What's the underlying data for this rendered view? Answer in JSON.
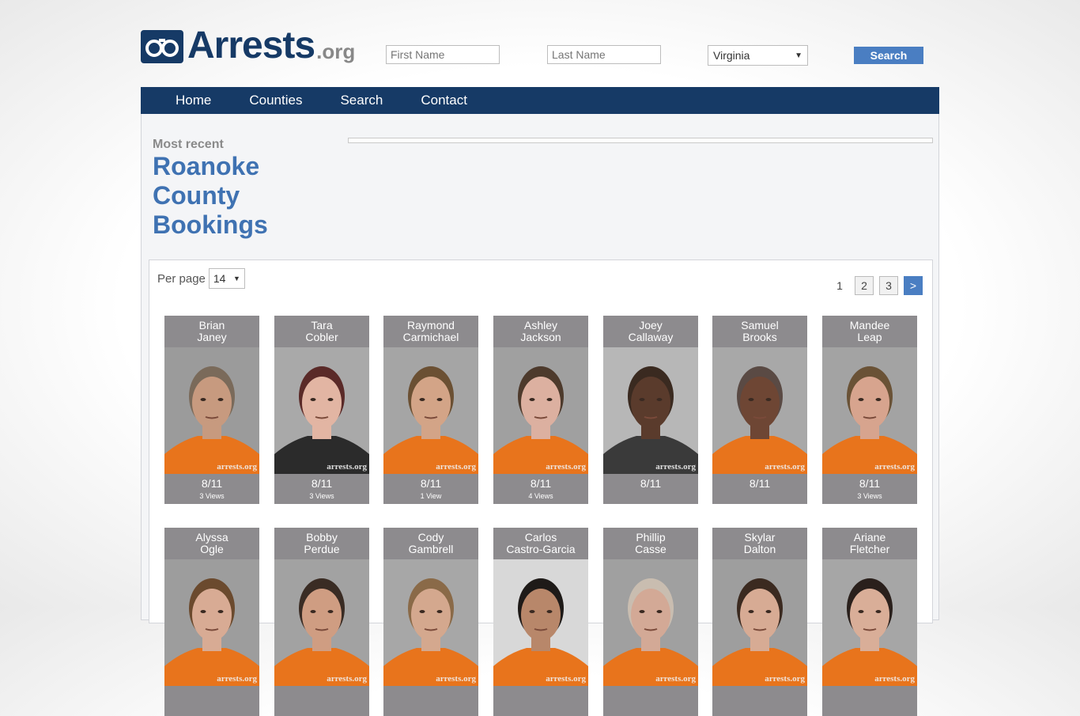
{
  "logo": {
    "brand": "Arrests",
    "tld": ".org"
  },
  "search": {
    "first_placeholder": "First Name",
    "last_placeholder": "Last Name",
    "state_selected": "Virginia",
    "button_label": "Search"
  },
  "nav": {
    "items": [
      "Home",
      "Counties",
      "Search",
      "Contact"
    ]
  },
  "page": {
    "eyebrow": "Most recent",
    "title": "Roanoke County Bookings"
  },
  "listing": {
    "per_page_label": "Per page",
    "per_page_value": "14",
    "pages": [
      "1",
      "2",
      "3"
    ],
    "current_page": "1",
    "next_label": ">"
  },
  "watermark": "arrests.org",
  "bookings": [
    {
      "first": "Brian",
      "last": "Janey",
      "date": "8/11",
      "views": "3 Views",
      "shirt": "#e8741c",
      "skin": "#c79a7f",
      "hair": "#7a6a5a",
      "bg": "#9b9b9b"
    },
    {
      "first": "Tara",
      "last": "Cobler",
      "date": "8/11",
      "views": "3 Views",
      "shirt": "#2b2b2b",
      "skin": "#e2b5a3",
      "hair": "#5a2a28",
      "bg": "#a9a9a9"
    },
    {
      "first": "Raymond",
      "last": "Carmichael",
      "date": "8/11",
      "views": "1 View",
      "shirt": "#e8741c",
      "skin": "#d3a487",
      "hair": "#6b5033",
      "bg": "#a5a5a5"
    },
    {
      "first": "Ashley",
      "last": "Jackson",
      "date": "8/11",
      "views": "4 Views",
      "shirt": "#e8741c",
      "skin": "#dcb0a0",
      "hair": "#4d3a2c",
      "bg": "#a0a0a0"
    },
    {
      "first": "Joey",
      "last": "Callaway",
      "date": "8/11",
      "views": "",
      "shirt": "#3a3a3a",
      "skin": "#5a3b2c",
      "hair": "#3a2a20",
      "bg": "#b7b7b7"
    },
    {
      "first": "Samuel",
      "last": "Brooks",
      "date": "8/11",
      "views": "",
      "shirt": "#e8741c",
      "skin": "#6e4634",
      "hair": "#5a4a44",
      "bg": "#a8a8a8"
    },
    {
      "first": "Mandee",
      "last": "Leap",
      "date": "8/11",
      "views": "3 Views",
      "shirt": "#e8741c",
      "skin": "#d7a48e",
      "hair": "#6a5236",
      "bg": "#a3a3a3"
    },
    {
      "first": "Alyssa",
      "last": "Ogle",
      "date": "",
      "views": "",
      "shirt": "#e8741c",
      "skin": "#d8ab94",
      "hair": "#6b4a2e",
      "bg": "#9d9d9d"
    },
    {
      "first": "Bobby",
      "last": "Perdue",
      "date": "",
      "views": "",
      "shirt": "#e8741c",
      "skin": "#cf9d82",
      "hair": "#3a2c24",
      "bg": "#a2a2a2"
    },
    {
      "first": "Cody",
      "last": "Gambrell",
      "date": "",
      "views": "",
      "shirt": "#e8741c",
      "skin": "#d4a88e",
      "hair": "#8a6a48",
      "bg": "#a7a7a7"
    },
    {
      "first": "Carlos",
      "last": "Castro-Garcia",
      "date": "",
      "views": "",
      "shirt": "#e8741c",
      "skin": "#b8876a",
      "hair": "#1e1a18",
      "bg": "#d8d8d8"
    },
    {
      "first": "Phillip",
      "last": "Casse",
      "date": "",
      "views": "",
      "shirt": "#e8741c",
      "skin": "#d3a996",
      "hair": "#c9bdb0",
      "bg": "#a0a0a0"
    },
    {
      "first": "Skylar",
      "last": "Dalton",
      "date": "",
      "views": "",
      "shirt": "#e8741c",
      "skin": "#d7ab94",
      "hair": "#3b2a20",
      "bg": "#9e9e9e"
    },
    {
      "first": "Ariane",
      "last": "Fletcher",
      "date": "",
      "views": "",
      "shirt": "#e8741c",
      "skin": "#d9ae98",
      "hair": "#2a201c",
      "bg": "#a6a6a6"
    }
  ]
}
